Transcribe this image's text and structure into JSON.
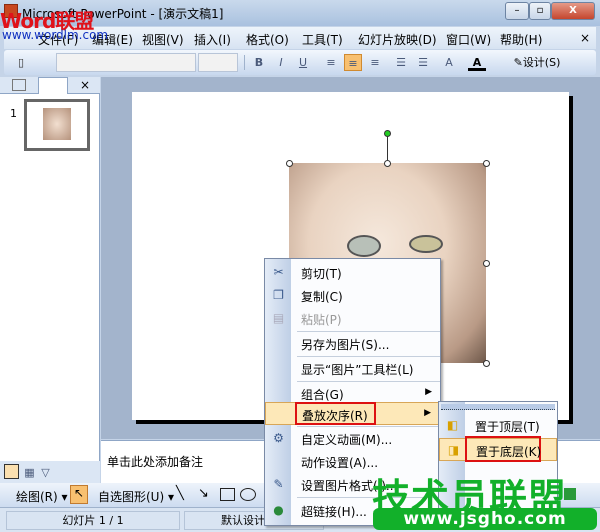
{
  "window": {
    "title": "Microsoft PowerPoint - [演示文稿1]",
    "minimize": "–",
    "restore": "▫",
    "close": "X"
  },
  "watermarks": {
    "top_logo": "Word联盟",
    "top_url": "www.wordlm.com",
    "bottom_logo": "技术员联盟",
    "bottom_url": "www.jsgho.com"
  },
  "menubar": {
    "items": [
      "文件(F)",
      "编辑(E)",
      "视图(V)",
      "插入(I)",
      "格式(O)",
      "工具(T)",
      "幻灯片放映(D)",
      "窗口(W)",
      "帮助(H)"
    ],
    "close": "×"
  },
  "toolbar": {
    "bold": "B",
    "italic": "I",
    "underline": "U",
    "design": "设计(S)",
    "font_value": "",
    "size_value": ""
  },
  "left_pane": {
    "slide_number": "1",
    "tab_close": "×"
  },
  "notes": {
    "placeholder": "单击此处添加备注"
  },
  "drawing_toolbar": {
    "draw": "绘图(R)",
    "autoshapes": "自选图形(U)"
  },
  "status": {
    "slide": "幻灯片 1 / 1",
    "design": "默认设计模板"
  },
  "context_menu": {
    "items": [
      {
        "label": "剪切(T)",
        "icon": "scissors-icon"
      },
      {
        "label": "复制(C)",
        "icon": "copy-icon"
      },
      {
        "label": "粘贴(P)",
        "icon": "paste-icon",
        "disabled": true
      },
      {
        "label": "另存为图片(S)..."
      },
      {
        "label": "显示“图片”工具栏(L)"
      },
      {
        "label": "组合(G)",
        "submenu": true
      },
      {
        "label": "叠放次序(R)",
        "submenu": true,
        "highlighted": true
      },
      {
        "label": "自定义动画(M)...",
        "icon": "animation-icon"
      },
      {
        "label": "动作设置(A)..."
      },
      {
        "label": "设置图片格式(I)...",
        "icon": "format-picture-icon"
      },
      {
        "label": "超链接(H)...",
        "icon": "hyperlink-icon"
      }
    ]
  },
  "submenu": {
    "items": [
      {
        "label": "置于顶层(T)"
      },
      {
        "label": "置于底层(K)",
        "highlighted": true
      }
    ]
  },
  "colors": {
    "highlight": "#fde8b8",
    "annotation_box": "#dd1111",
    "watermark_green": "#12b02a"
  }
}
